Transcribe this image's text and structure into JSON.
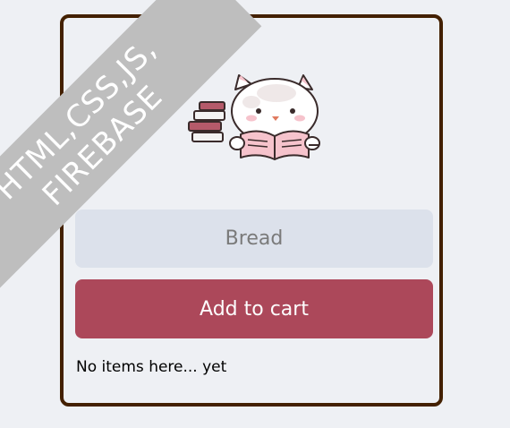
{
  "ribbon": {
    "line1": "HTML,CSS,JS,",
    "line2": "FIREBASE"
  },
  "form": {
    "input_placeholder": "Bread",
    "input_value": "",
    "add_button_label": "Add to cart"
  },
  "list": {
    "empty_message": "No items here... yet",
    "items": []
  },
  "colors": {
    "background": "#EEF0F4",
    "card_border": "#432000",
    "input_background": "#DCE1EB",
    "button_background": "#AC485A",
    "button_text": "#FDFDFD",
    "ribbon": "#BEBEBE"
  },
  "icons": {
    "mascot": "cat-reading-book-icon"
  }
}
